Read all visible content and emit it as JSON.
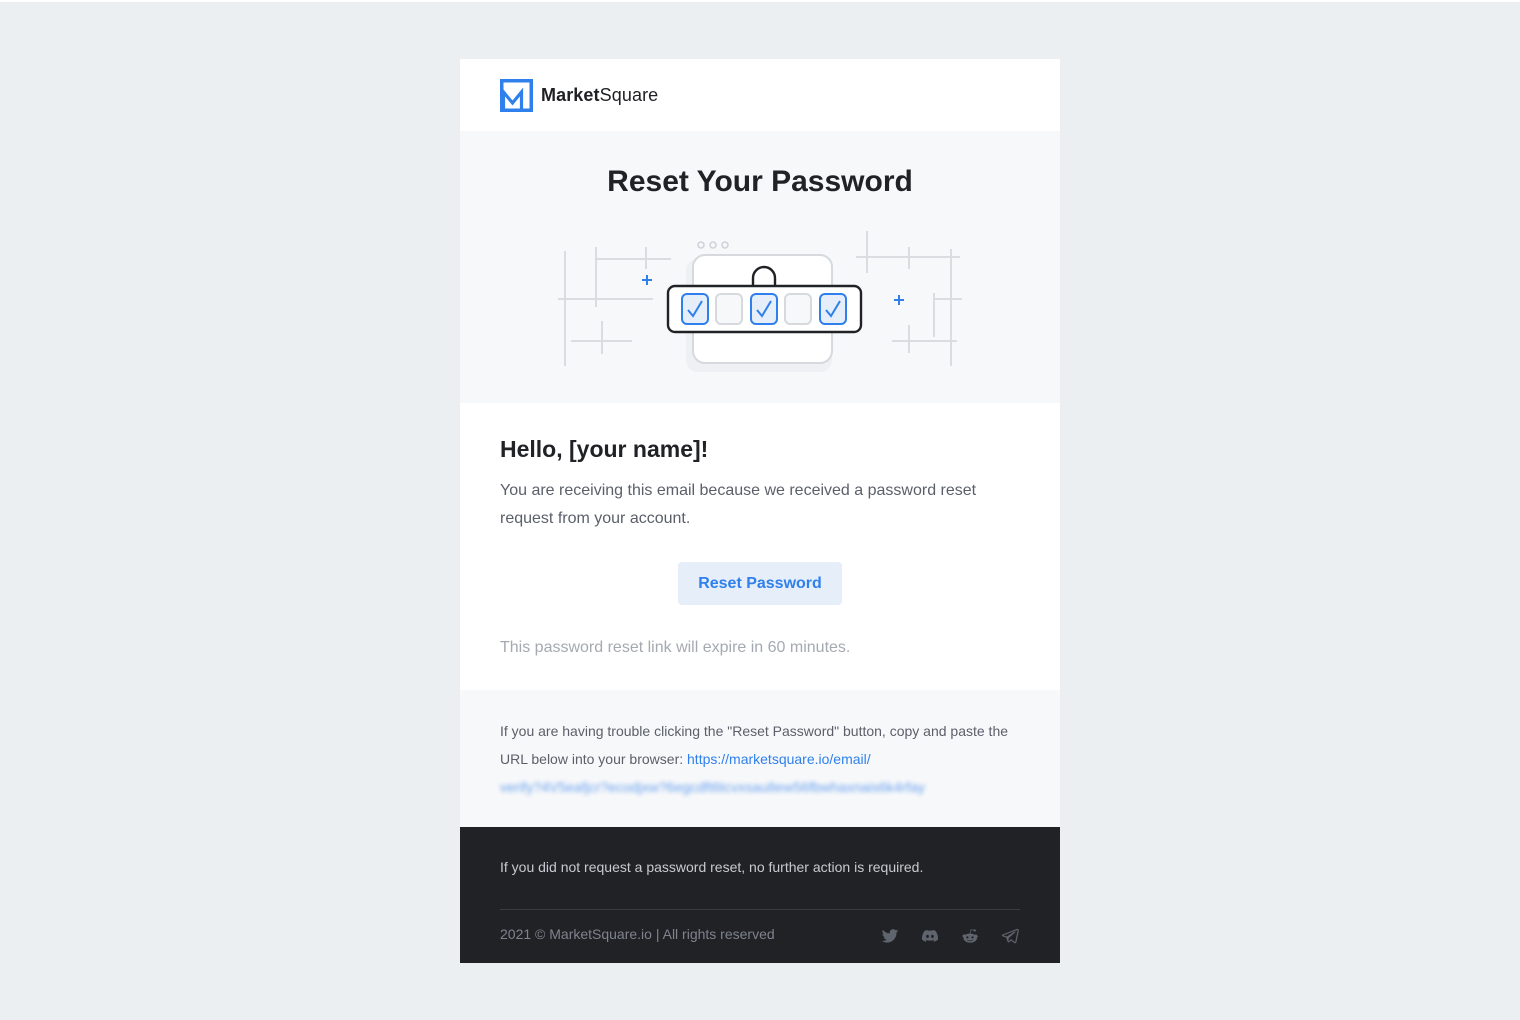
{
  "brand": {
    "name_bold": "Market",
    "name_regular": "Square",
    "accent": "#2f80ed"
  },
  "hero": {
    "title": "Reset Your Password"
  },
  "body": {
    "greeting": "Hello, [your name]!",
    "message": "You are receiving this email because we received a password reset request from your account.",
    "button_label": "Reset Password",
    "expiry": "This password reset link will expire in 60 minutes."
  },
  "help": {
    "text_prefix": "If you are having trouble clicking the \"Reset Password\" button, copy and paste the URL below into your browser: ",
    "url": "https://marketsquare.io/email/",
    "url_blurred": "verify?4V5eafjcr?ecodjxw?6egcdft6tcvxsau8ew56fbwhaxnais6k4rfay"
  },
  "footer": {
    "note": "If you did not request a password reset, no further action is required.",
    "copyright": "2021 © MarketSquare.io | All rights reserved",
    "socials": [
      "twitter-icon",
      "discord-icon",
      "reddit-icon",
      "telegram-icon"
    ]
  },
  "colors": {
    "background": "#eceff2",
    "footer": "#212226",
    "link": "#2f80ed",
    "button_bg": "#e5eef9"
  }
}
